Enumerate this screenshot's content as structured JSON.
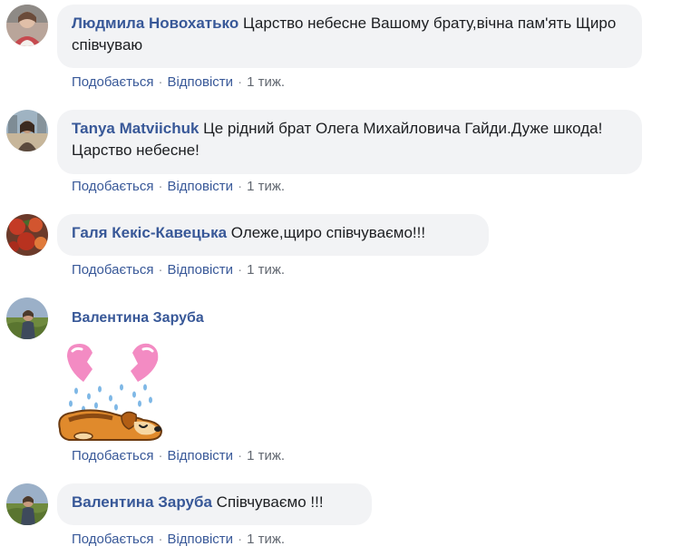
{
  "actions": {
    "like": "Подобається",
    "reply": "Відповісти",
    "separator": "·",
    "time": "1 тиж."
  },
  "comments": [
    {
      "author": "Людмила Новохатько",
      "text": " Царство небесне Вашому брату,вічна пам'ять Щиро співчуваю"
    },
    {
      "author": "Tanya Matviichuk",
      "text": " Це рідний брат Олега Михайловича Гайди.Дуже шкода! Царство небесне!"
    },
    {
      "author": "Галя Кекіс-Кавецька",
      "text": " Олеже,щиро співчуваємо!!!"
    },
    {
      "author": "Валентина Заруба",
      "sticker": "broken-heart-dog-sticker"
    },
    {
      "author": "Валентина Заруба",
      "text": " Співчуваємо !!!"
    }
  ],
  "colors": {
    "author": "#385898",
    "bubble": "#f2f3f5",
    "text": "#1c1e21",
    "meta": "#616770"
  }
}
